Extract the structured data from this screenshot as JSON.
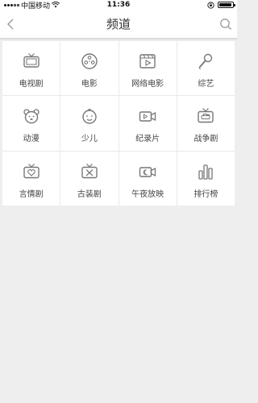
{
  "status_bar": {
    "carrier": "中国移动",
    "time": "11:36",
    "battery_level": 0.95
  },
  "header": {
    "title": "频道"
  },
  "channels": [
    {
      "label": "电视剧",
      "icon": "tv-icon"
    },
    {
      "label": "电影",
      "icon": "film-reel-icon"
    },
    {
      "label": "网络电影",
      "icon": "video-player-icon"
    },
    {
      "label": "综艺",
      "icon": "microphone-icon"
    },
    {
      "label": "动漫",
      "icon": "bear-face-icon"
    },
    {
      "label": "少儿",
      "icon": "child-face-icon"
    },
    {
      "label": "纪录片",
      "icon": "camera-icon"
    },
    {
      "label": "战争剧",
      "icon": "tank-tv-icon"
    },
    {
      "label": "言情剧",
      "icon": "heart-tv-icon"
    },
    {
      "label": "古装剧",
      "icon": "crossed-swords-tv-icon"
    },
    {
      "label": "午夜放映",
      "icon": "night-camera-icon"
    },
    {
      "label": "排行榜",
      "icon": "ranking-bars-icon"
    }
  ]
}
